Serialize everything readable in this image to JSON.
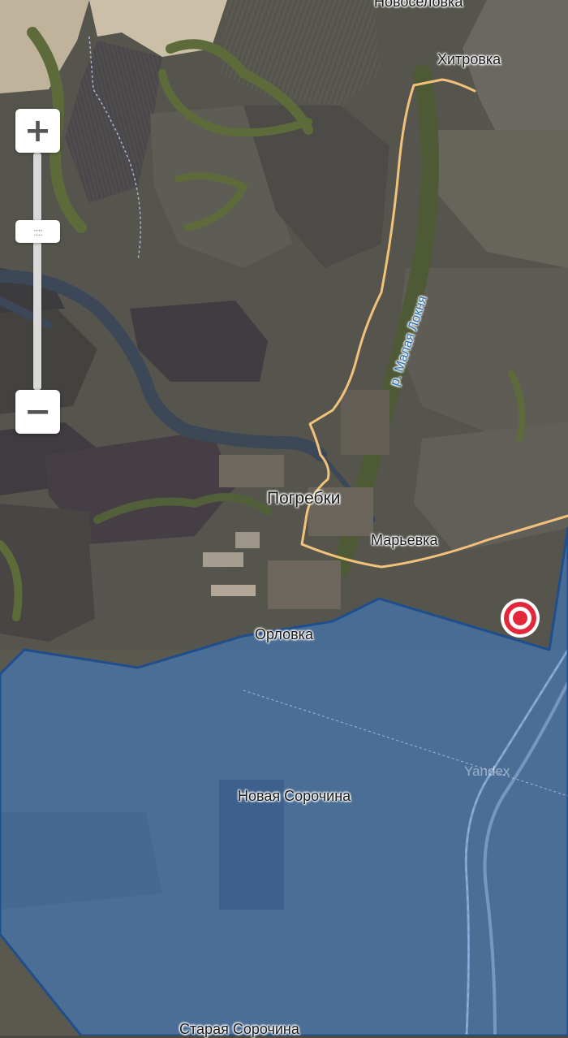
{
  "map": {
    "watermark": "Yandex",
    "labels": {
      "novoselovka": "Новоселовка",
      "khitrovka": "Хитровка",
      "river": "р. Малая Локня",
      "pogrebki": "Погребки",
      "maryevka": "Марьевка",
      "orlovka": "Орловка",
      "novaya_sorochina": "Новая Сорочина",
      "staraya_sorochina": "Старая Сорочина"
    }
  },
  "zoom": {
    "in_label": "+",
    "out_label": "−",
    "handle_label": "::::"
  },
  "colors": {
    "road": "#f2c27a",
    "occupied_fill": "#3f7fd0",
    "occupied_border": "#1f4e8c",
    "marker": "#e2283a"
  }
}
